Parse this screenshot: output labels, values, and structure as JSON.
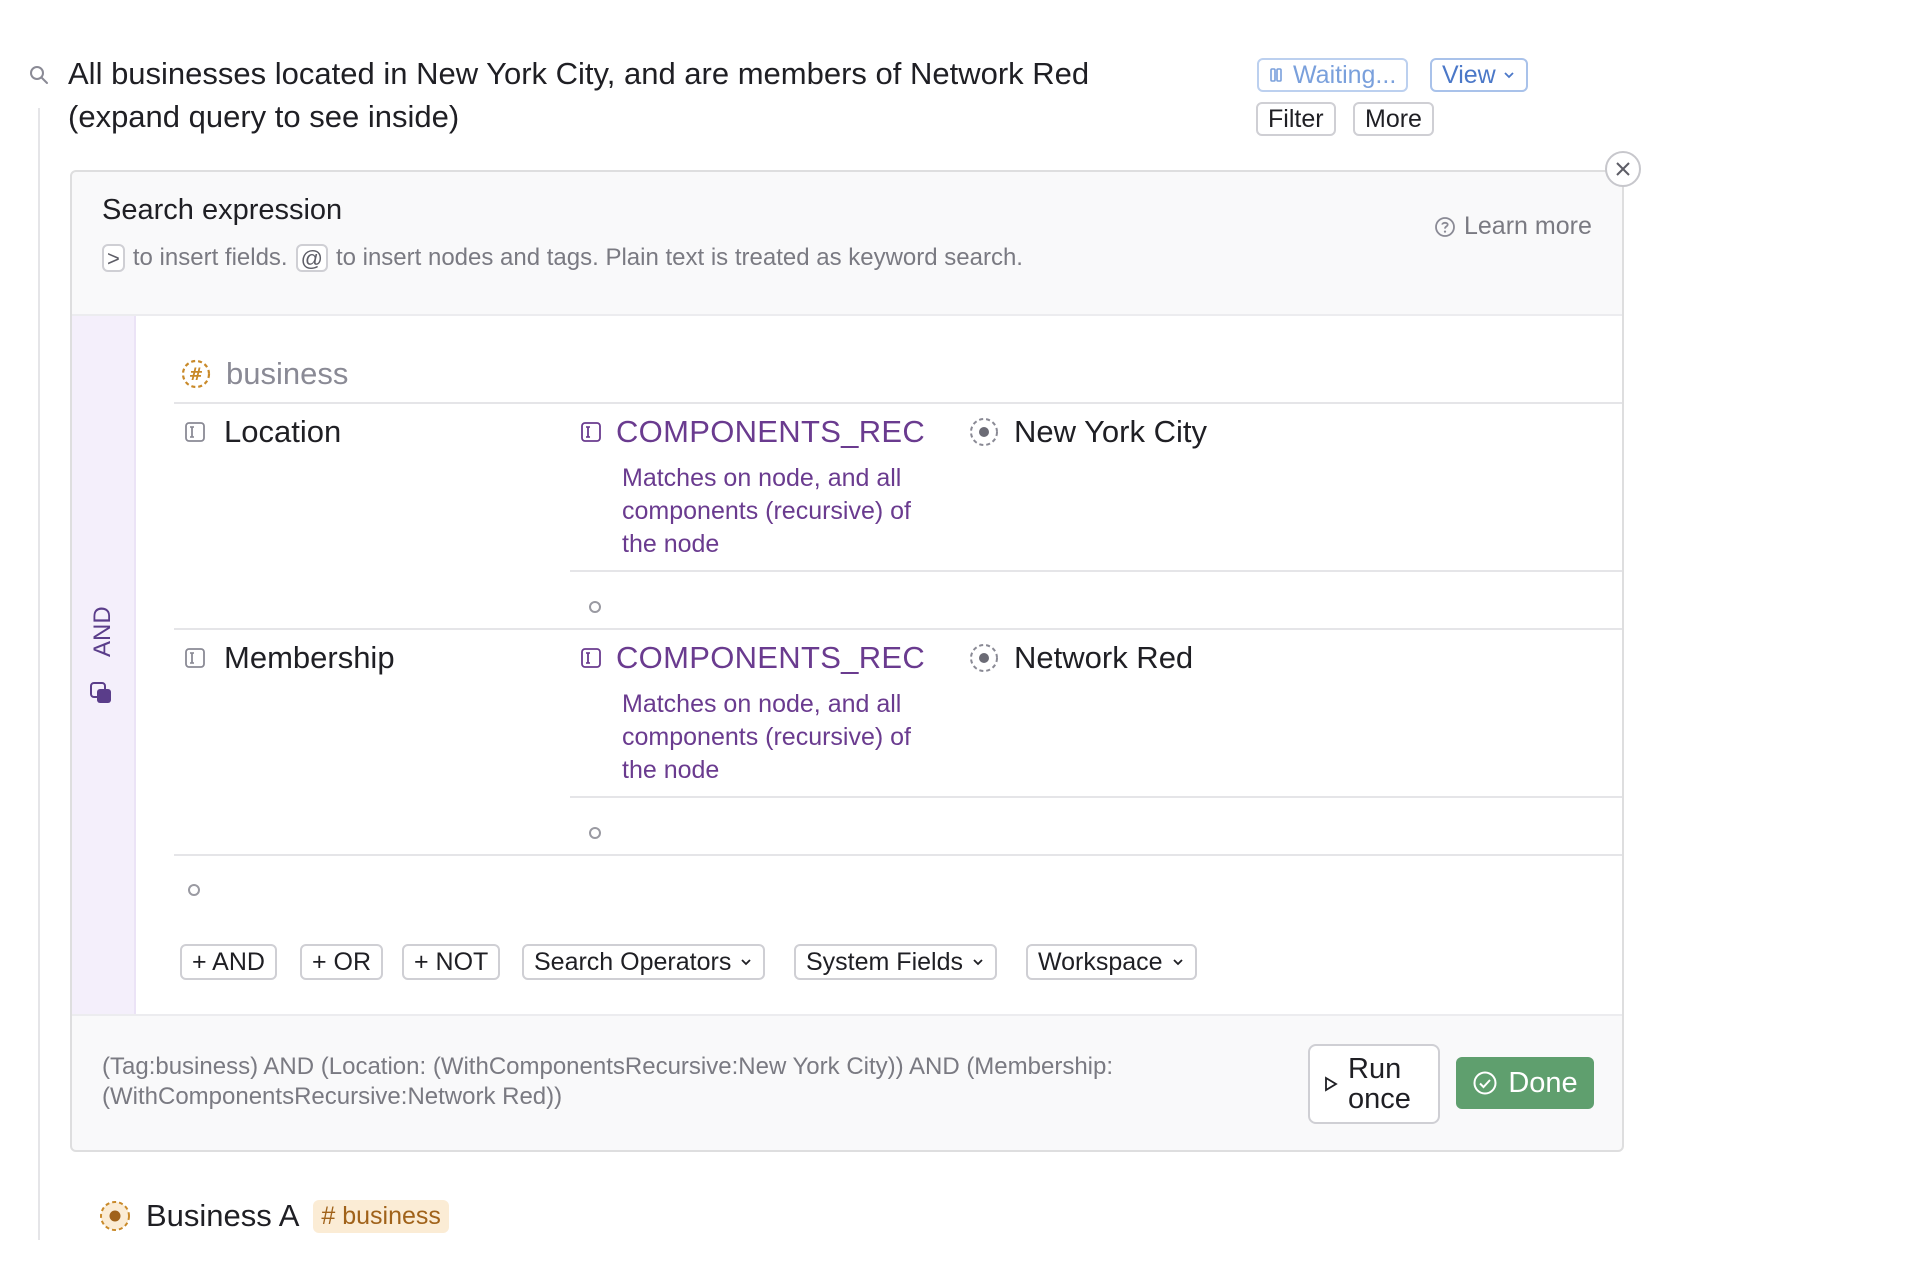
{
  "header": {
    "query_title": "All businesses located in New York City, and are members of Network Red (expand query to see inside)",
    "waiting_label": "Waiting...",
    "view_label": "View",
    "filter_label": "Filter",
    "more_label": "More"
  },
  "panel": {
    "title": "Search expression",
    "hint_key_fields": ">",
    "hint_fields_text": "to insert fields.",
    "hint_key_nodes": "@",
    "hint_nodes_text": "to insert nodes and tags. Plain text is treated as keyword search.",
    "learn_more": "Learn more",
    "and_label": "AND",
    "tag_name": "business",
    "rows": [
      {
        "field": "Location",
        "operator": "COMPONENTS_REC",
        "operator_desc": "Matches on node, and all components (recursive) of the node",
        "value": "New York City"
      },
      {
        "field": "Membership",
        "operator": "COMPONENTS_REC",
        "operator_desc": "Matches on node, and all components (recursive) of the node",
        "value": "Network Red"
      }
    ],
    "buttons": {
      "and": "+ AND",
      "or": "+ OR",
      "not": "+ NOT",
      "search_operators": "Search Operators",
      "system_fields": "System Fields",
      "workspace": "Workspace"
    },
    "expression": "(Tag:business) AND (Location: (WithComponentsRecursive:New York City)) AND (Membership: (WithComponentsRecursive:Network Red))",
    "run_once": "Run once",
    "done": "Done"
  },
  "result": {
    "name": "Business A",
    "tag": "# business"
  },
  "colors": {
    "accent_purple": "#6a3b8f",
    "done_green": "#5f9f6e",
    "tag_orange": "#a0621a",
    "view_blue": "#4b78c8"
  }
}
